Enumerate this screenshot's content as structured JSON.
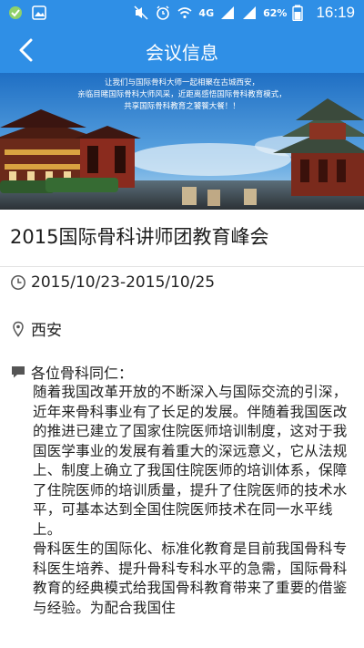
{
  "status_bar": {
    "network": "4G",
    "battery": "62%",
    "time": "16:19"
  },
  "header": {
    "title": "会议信息",
    "back_icon": "back-arrow-icon"
  },
  "banner": {
    "lines": [
      "让我们与国际骨科大师一起相聚在古城西安，",
      "亲临目睹国际骨科大师风采，近距离感悟国际骨科教育模式，",
      "共享国际骨科教育之饕餮大餐！！"
    ]
  },
  "event": {
    "title": "2015国际骨科讲师团教育峰会",
    "date": "2015/10/23-2015/10/25",
    "location": "西安",
    "greeting": "各位骨科同仁：",
    "paragraphs": [
      "随着我国改革开放的不断深入与国际交流的引深，近年来骨科事业有了长足的发展。伴随着我国医改的推进已建立了国家住院医师培训制度，这对于我国医学事业的发展有着重大的深远意义，它从法规上、制度上确立了我国住院医师的培训体系，保障了住院医师的培训质量，提升了住院医师的技术水平，可基本达到全国住院医师技术在同一水平线上。",
      "骨科医生的国际化、标准化教育是目前我国骨科专科医生培养、提升骨科专科水平的急需，国际骨科教育的经典模式给我国骨科教育带来了重要的借鉴与经验。为配合我国住"
    ]
  },
  "colors": {
    "primary": "#2f8fe6"
  }
}
